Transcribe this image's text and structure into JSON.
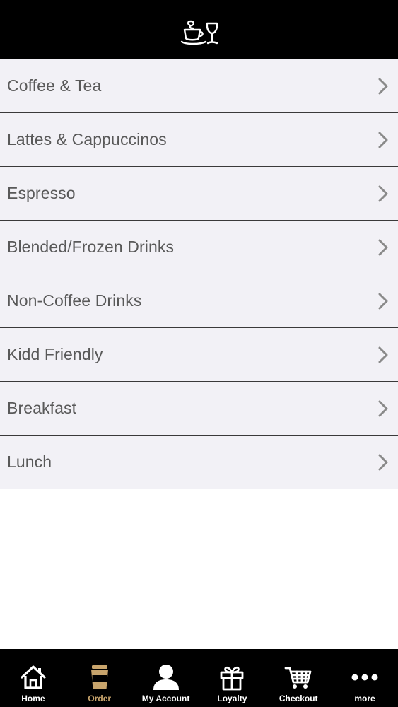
{
  "menu": {
    "items": [
      {
        "label": "Coffee & Tea"
      },
      {
        "label": "Lattes & Cappuccinos"
      },
      {
        "label": "Espresso"
      },
      {
        "label": "Blended/Frozen Drinks"
      },
      {
        "label": "Non-Coffee Drinks"
      },
      {
        "label": "Kidd Friendly"
      },
      {
        "label": "Breakfast"
      },
      {
        "label": "Lunch"
      }
    ]
  },
  "tabbar": {
    "active_index": 1,
    "active_color": "#c8a46c",
    "tabs": [
      {
        "label": "Home",
        "icon": "home-icon"
      },
      {
        "label": "Order",
        "icon": "coffee-cup-icon"
      },
      {
        "label": "My Account",
        "icon": "user-icon"
      },
      {
        "label": "Loyalty",
        "icon": "gift-icon"
      },
      {
        "label": "Checkout",
        "icon": "cart-icon"
      },
      {
        "label": "more",
        "icon": "more-dots-icon"
      }
    ]
  }
}
